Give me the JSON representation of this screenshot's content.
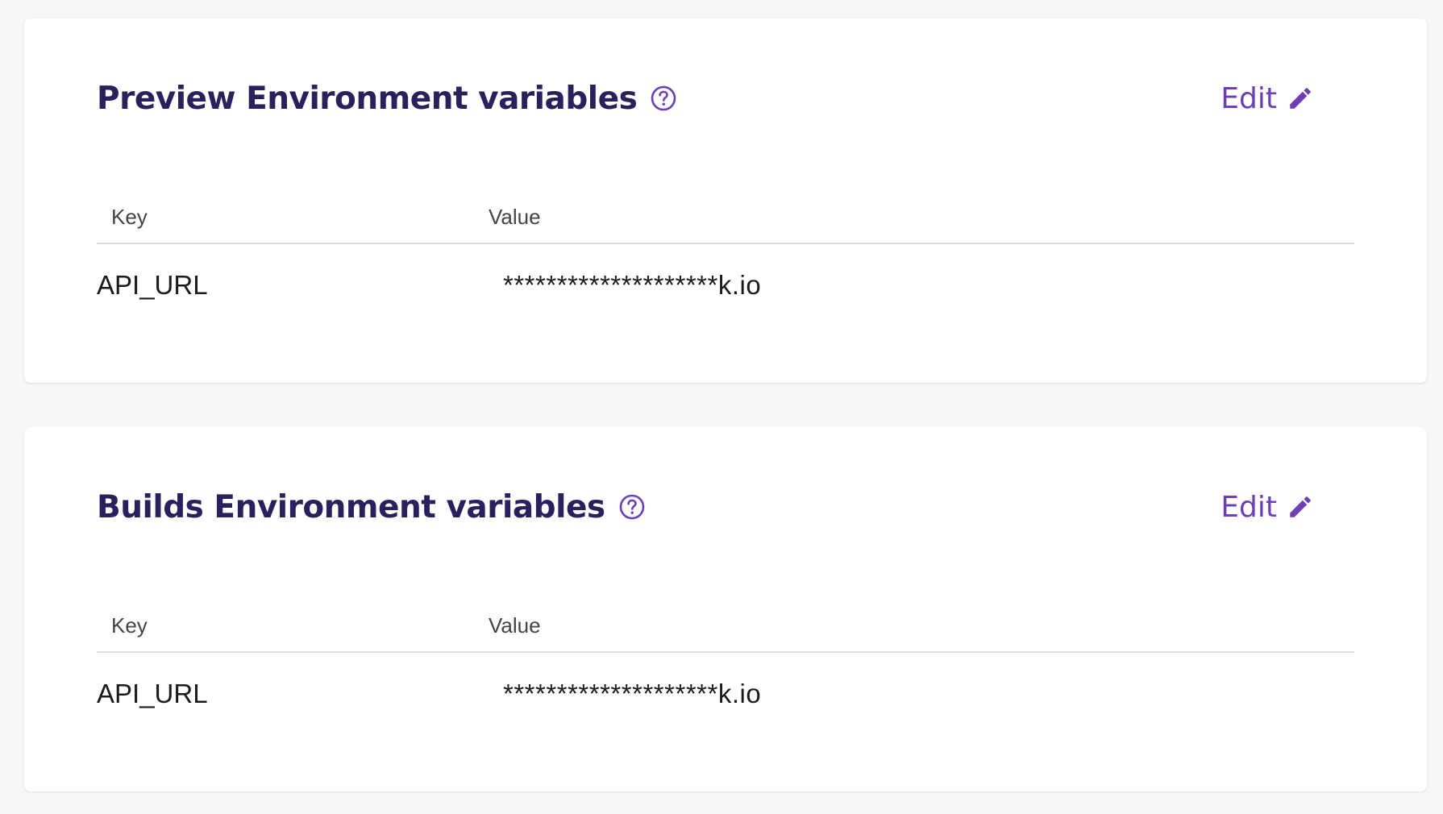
{
  "colors": {
    "title": "#2b1f5c",
    "accent": "#6c3fb4",
    "background": "#f7f7f7",
    "card": "#ffffff"
  },
  "sections": [
    {
      "title": "Preview Environment variables",
      "help_icon": "question-circle-icon",
      "edit_label": "Edit",
      "edit_icon": "pencil-icon",
      "columns": [
        "Key",
        "Value"
      ],
      "rows": [
        {
          "key": "API_URL",
          "value": "********************k.io"
        }
      ]
    },
    {
      "title": "Builds Environment variables",
      "help_icon": "question-circle-icon",
      "edit_label": "Edit",
      "edit_icon": "pencil-icon",
      "columns": [
        "Key",
        "Value"
      ],
      "rows": [
        {
          "key": "API_URL",
          "value": "********************k.io"
        }
      ]
    }
  ]
}
